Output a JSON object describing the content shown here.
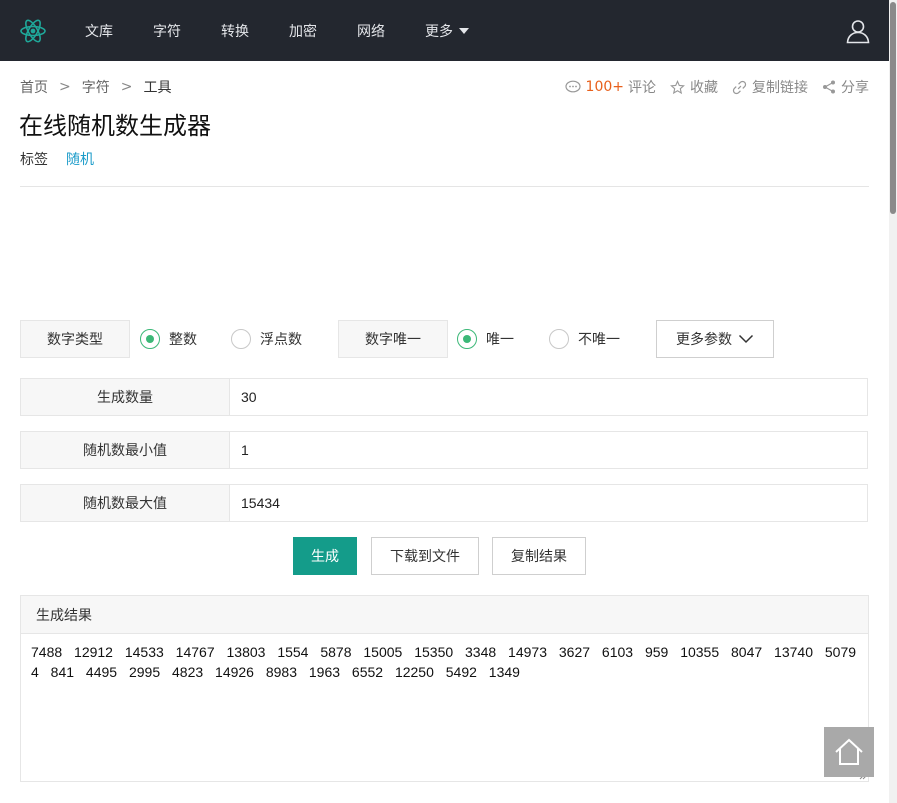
{
  "nav": {
    "items": [
      "文库",
      "字符",
      "转换",
      "加密",
      "网络"
    ],
    "more_label": "更多"
  },
  "breadcrumb": {
    "items": [
      "首页",
      "字符",
      "工具"
    ],
    "separator": ">"
  },
  "actions": {
    "comments_count": "100+",
    "comments_label": "评论",
    "favorite_label": "收藏",
    "copy_link_label": "复制链接",
    "share_label": "分享"
  },
  "page": {
    "title": "在线随机数生成器",
    "tags_label": "标签",
    "tag": "随机"
  },
  "options": {
    "number_type_label": "数字类型",
    "integer_label": "整数",
    "float_label": "浮点数",
    "number_type_selected": "整数",
    "unique_label": "数字唯一",
    "unique_yes_label": "唯一",
    "unique_no_label": "不唯一",
    "unique_selected": "唯一",
    "more_params_label": "更多参数"
  },
  "fields": {
    "count_label": "生成数量",
    "count_value": "30",
    "min_label": "随机数最小值",
    "min_value": "1",
    "max_label": "随机数最大值",
    "max_value": "15434"
  },
  "buttons": {
    "generate": "生成",
    "download": "下载到文件",
    "copy": "复制结果"
  },
  "result": {
    "header": "生成结果",
    "text": "7488  12912  14533  14767  13803  1554  5878  15005  15350  3348  14973  3627  6103  959  10355  8047  13740  5079  4  841  4495  2995  4823  14926  8983  1963  6552  12250  5492  1349"
  },
  "colors": {
    "topbar": "#23272f",
    "accent": "#149c8a",
    "radio_checked": "#3cb878",
    "link": "#1a9bc9",
    "hot": "#e8601c"
  }
}
